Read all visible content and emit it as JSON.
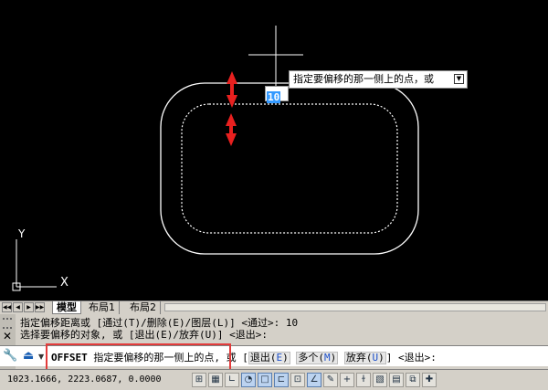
{
  "drawing": {
    "tooltip_prompt": "指定要偏移的那一侧上的点，或",
    "tooltip_down_icon": "down-arrow-icon",
    "dynamic_input_value": "10",
    "ucs_labels": {
      "y": "Y",
      "x": "X"
    }
  },
  "tabs": {
    "nav_icons": [
      "first-icon",
      "prev-icon",
      "next-icon",
      "last-icon"
    ],
    "items": [
      {
        "label": "模型",
        "active": true
      },
      {
        "label": "布局1",
        "active": false
      },
      {
        "label": "布局2",
        "active": false
      }
    ]
  },
  "command": {
    "history": [
      "指定偏移距离或 [通过(T)/删除(E)/图层(L)] <通过>: 10",
      "选择要偏移的对象, 或 [退出(E)/放弃(U)] <退出>:"
    ],
    "current": {
      "command_name": "OFFSET",
      "prompt": "指定要偏移的那一侧上的点,",
      "or": "或",
      "bracket_open": "[",
      "options": [
        {
          "label": "退出",
          "key": "E"
        },
        {
          "label": "多个",
          "key": "M"
        },
        {
          "label": "放弃",
          "key": "U"
        }
      ],
      "bracket_close": "]",
      "default": "<退出>:"
    },
    "close_label": "✕"
  },
  "status": {
    "coordinates": "1023.1666, 2223.0687, 0.0000",
    "buttons": [
      "snap-icon",
      "grid-icon",
      "ortho-icon",
      "polar-icon",
      "osnap-icon",
      "otrack-icon",
      "ducs-icon",
      "dyn-icon",
      "lineweight-icon",
      "transparency-icon",
      "quickprops-icon",
      "selection-cycling-icon",
      "annotation-monitor-icon",
      "model-space-icon",
      "settings-icon"
    ]
  },
  "colors": {
    "canvas_bg": "#000000",
    "geometry": "#ffffff",
    "arrow": "#e8201f",
    "highlight_box": "#e23b3b",
    "option_key": "#1c4fc9"
  }
}
